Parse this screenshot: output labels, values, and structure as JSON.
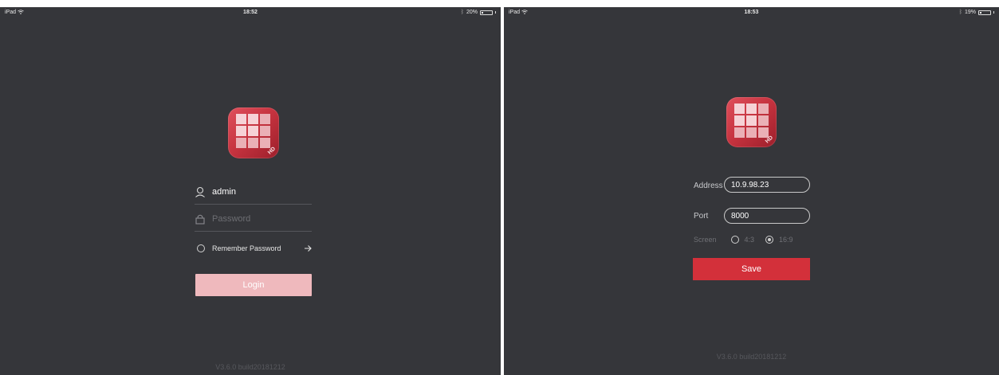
{
  "left_screen": {
    "status_bar": {
      "device": "iPad",
      "time": "18:52",
      "battery_text": "20%",
      "battery_level": 0.2
    },
    "app_icon": {
      "badge": "HD"
    },
    "username": {
      "value": "admin"
    },
    "password": {
      "placeholder": "Password"
    },
    "remember_label": "Remember Password",
    "login_label": "Login",
    "version": "V3.6.0 build20181212"
  },
  "right_screen": {
    "status_bar": {
      "device": "iPad",
      "time": "18:53",
      "battery_text": "19%",
      "battery_level": 0.19
    },
    "app_icon": {
      "badge": "HD"
    },
    "address": {
      "label": "Address",
      "value": "10.9.98.23"
    },
    "port": {
      "label": "Port",
      "value": "8000"
    },
    "screen_ratio": {
      "label": "Screen",
      "options": [
        "4:3",
        "16:9"
      ],
      "selected": "16:9"
    },
    "save_label": "Save",
    "version": "V3.6.0 build20181212"
  },
  "colors": {
    "background": "#35363a",
    "accent_red": "#d3303a",
    "login_pink": "#efb9bd",
    "icon_red": "#c4323e"
  },
  "icons": [
    "wifi-icon",
    "bluetooth-icon",
    "battery-icon",
    "user-icon",
    "lock-icon",
    "arrow-right-icon",
    "app-grid-icon"
  ]
}
